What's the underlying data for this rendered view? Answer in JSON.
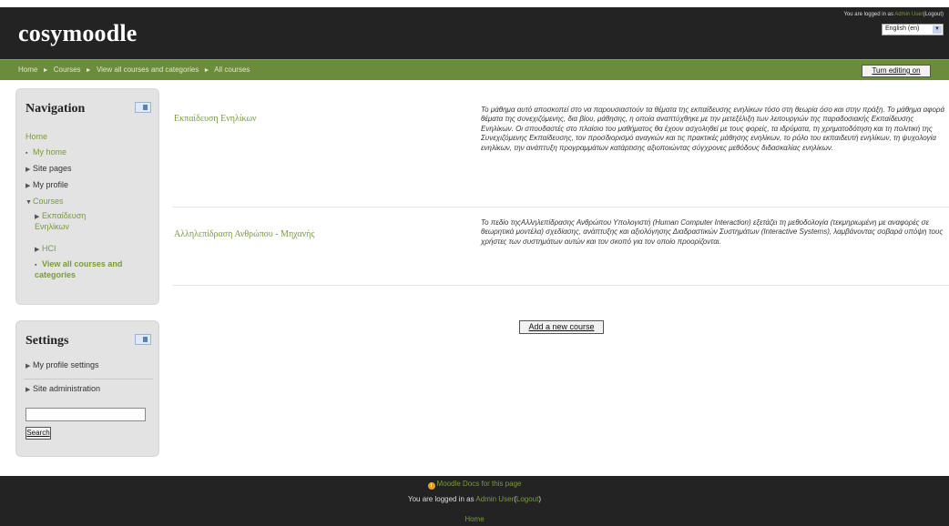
{
  "site": {
    "title": "cosymoodle"
  },
  "login": {
    "prefix": "You are logged in as",
    "user": "Admin User",
    "open_paren": "(",
    "logout": "Logout",
    "close_paren": ")"
  },
  "language": {
    "selected": "English (en)"
  },
  "breadcrumb": {
    "items": [
      "Home",
      "Courses",
      "View all courses and categories",
      "All courses"
    ],
    "separator": "►"
  },
  "editing_button": "Turn editing on",
  "navigation": {
    "title": "Navigation",
    "home": "Home",
    "my_home": "My home",
    "site_pages": "Site pages",
    "my_profile": "My profile",
    "courses": "Courses",
    "course_1": "Εκπαίδευση Ενηλίκων",
    "course_2": "HCI",
    "view_all": "View all courses and categories"
  },
  "settings": {
    "title": "Settings",
    "my_profile_settings": "My profile settings",
    "site_administration": "Site administration",
    "search_value": "",
    "search_button": "Search"
  },
  "courses": [
    {
      "name": "Εκπαίδευση Ενηλίκων",
      "summary": "Το μάθημα αυτό αποσκοπεί στο να παρουσιαστούν τα θέματα της εκπαίδευσης ενηλίκων τόσο στη θεωρία όσο και στην πράξη. Το μάθημα αφορά θέματα της συνεχιζόμενης, δια βίου, μάθησης, η οποία αναπτύχθηκε με την μετεξέλιξη των λειτουργιών της παραδοσιακής Εκπαίδευσης Ενηλίκων. Οι σπουδαστές στο πλαίσιο του μαθήματος θα έχουν ασχοληθεί με τους φορείς, τα ιδρύματα, τη χρηματοδότηση και τη πολιτική της Συνεχιζόμενης Εκπαίδευσης, τον προσδιορισμό αναγκών και τις πρακτικές μάθησης ενηλίκων, το ρόλο του εκπαιδευτή ενηλίκων, τη ψυχολογία ενηλίκων, την ανάπτυξη προγραμμάτων κατάρτισης αξιοποιώντας σύγχρονες μεθόδους διδασκαλίας ενηλίκων."
    },
    {
      "name": "Αλληλεπίδραση Ανθρώπου - Μηχανής",
      "summary": "Το πεδίο τηςΑλληλεπίδρασης Ανθρώπου Υπολογιστή (Human Computer Interaction) εξετάζει τη μεθοδολογία (τεκμηριωμένη με αναφορές σε θεωρητικά μοντέλα) σχεδίασης, ανάπτυξης και αξιολόγησης Διαδραστικών Συστημάτων (Interactive Systems), λαμβάνοντας σοβαρά υπόψη τους χρήστες των συστημάτων αυτών και τον σκοπό για τον οποίο προορίζονται."
    }
  ],
  "add_course_button": "Add a new course",
  "footer": {
    "docs_link": "Moodle Docs for this page",
    "home": "Home"
  },
  "colors": {
    "header_bg": "#232323",
    "navbar_bg": "#6b8c3a",
    "link": "#7a9a3d",
    "block_bg": "#e3e3e3"
  },
  "icons": {
    "dock": "dock-block-icon",
    "info": "info-icon",
    "triangle_right": "collapsed-arrow-icon",
    "triangle_down": "expanded-arrow-icon",
    "bullet": "bullet-icon"
  }
}
